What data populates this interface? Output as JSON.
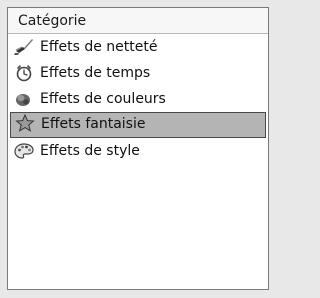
{
  "panel": {
    "header": "Catégorie",
    "items": [
      {
        "label": "Effets de netteté",
        "icon": "brush-icon",
        "selected": false
      },
      {
        "label": "Effets de temps",
        "icon": "clock-icon",
        "selected": false
      },
      {
        "label": "Effets de couleurs",
        "icon": "color-blob-icon",
        "selected": false
      },
      {
        "label": "Effets fantaisie",
        "icon": "star-icon",
        "selected": true
      },
      {
        "label": "Effets de style",
        "icon": "palette-icon",
        "selected": false
      }
    ]
  },
  "colors": {
    "selection_bg": "#b4b4b4",
    "selection_border": "#4a4a4a",
    "panel_bg": "#ffffff",
    "page_bg": "#e8e8e8"
  }
}
